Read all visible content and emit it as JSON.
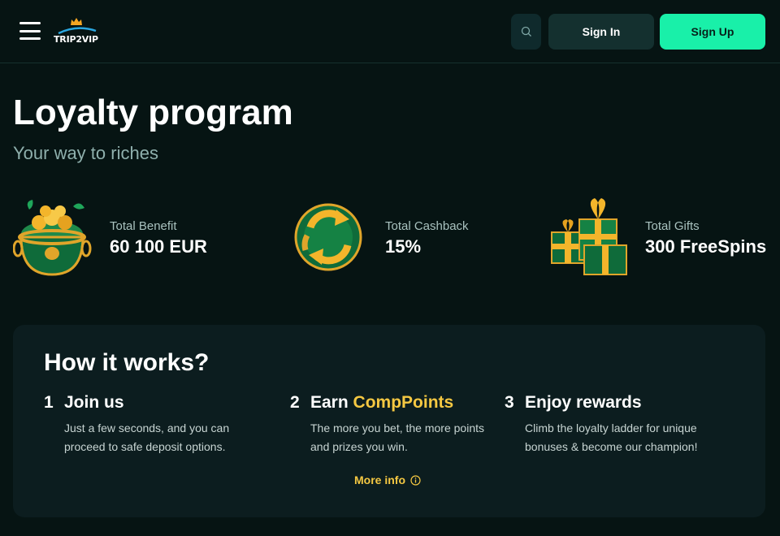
{
  "header": {
    "logo_text": "TRIP2VIP",
    "signin_label": "Sign In",
    "signup_label": "Sign Up"
  },
  "hero": {
    "title": "Loyalty program",
    "subtitle": "Your way to riches"
  },
  "stats": [
    {
      "label": "Total Benefit",
      "value": "60 100 EUR",
      "icon": "pot-of-gold-icon"
    },
    {
      "label": "Total Cashback",
      "value": "15%",
      "icon": "cashback-cycle-icon"
    },
    {
      "label": "Total Gifts",
      "value": "300 FreeSpins",
      "icon": "gift-boxes-icon"
    }
  ],
  "how_it_works": {
    "title": "How it works?",
    "steps": [
      {
        "num": "1",
        "title": "Join us",
        "title_accent": "",
        "desc": "Just a few seconds, and you can proceed to safe deposit options."
      },
      {
        "num": "2",
        "title": "Earn ",
        "title_accent": "CompPoints",
        "desc": "The more you bet, the more points and prizes you win."
      },
      {
        "num": "3",
        "title": "Enjoy rewards",
        "title_accent": "",
        "desc": "Climb the loyalty ladder for unique bonuses & become our champion!"
      }
    ],
    "more_info_label": "More info"
  },
  "colors": {
    "background": "#061413",
    "accent_green": "#19f0a9",
    "accent_gold": "#f5c842",
    "card": "#0c1d1f"
  }
}
